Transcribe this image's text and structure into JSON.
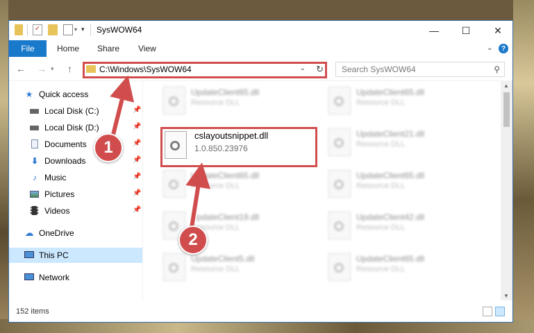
{
  "window": {
    "title": "SysWOW64",
    "minimize_glyph": "—",
    "maximize_glyph": "☐",
    "close_glyph": "✕"
  },
  "ribbon": {
    "file_label": "File",
    "tabs": [
      "Home",
      "Share",
      "View"
    ],
    "help_glyph": "?"
  },
  "address": {
    "path": "C:\\Windows\\SysWOW64",
    "search_placeholder": "Search SysWOW64"
  },
  "sidebar": {
    "items": [
      {
        "label": "Quick access",
        "icon": "star-icon"
      },
      {
        "label": "Local Disk (C:)",
        "icon": "drive-icon",
        "pinned": true
      },
      {
        "label": "Local Disk (D:)",
        "icon": "drive-icon",
        "pinned": true
      },
      {
        "label": "Documents",
        "icon": "documents-icon",
        "pinned": true
      },
      {
        "label": "Downloads",
        "icon": "downloads-icon",
        "pinned": true
      },
      {
        "label": "Music",
        "icon": "music-icon",
        "pinned": true
      },
      {
        "label": "Pictures",
        "icon": "pictures-icon",
        "pinned": true
      },
      {
        "label": "Videos",
        "icon": "videos-icon",
        "pinned": true
      },
      {
        "label": "OneDrive",
        "icon": "onedrive-icon"
      },
      {
        "label": "This PC",
        "icon": "pc-icon",
        "selected": true
      },
      {
        "label": "Network",
        "icon": "network-icon"
      }
    ]
  },
  "files": {
    "blurred_tiles": [
      {
        "name": "UpdateClient65.dll",
        "type": "Resource DLL"
      },
      {
        "name": "UpdateClient65.dll",
        "type": "Resource DLL"
      },
      {
        "name": "UpdateClient21.dll",
        "type": "Resource DLL"
      },
      {
        "name": "UpdateClient65.dll",
        "type": "Resource DLL"
      },
      {
        "name": "UpdateClient65.dll",
        "type": "Resource DLL"
      },
      {
        "name": "UpdateClient19.dll",
        "type": "Resource DLL"
      },
      {
        "name": "UpdateClient42.dll",
        "type": "Resource DLL"
      },
      {
        "name": "UpdateClient5.dll",
        "type": "Resource DLL"
      },
      {
        "name": "UpdateClient65.dll",
        "type": "Resource DLL"
      }
    ],
    "selected": {
      "name": "cslayoutsnippet.dll",
      "version": "1.0.850.23976"
    }
  },
  "status": {
    "item_count": "152 items"
  },
  "callouts": [
    "1",
    "2"
  ],
  "colors": {
    "accent": "#1979ca",
    "highlight": "#d14d4d",
    "selection": "#cce8ff"
  }
}
